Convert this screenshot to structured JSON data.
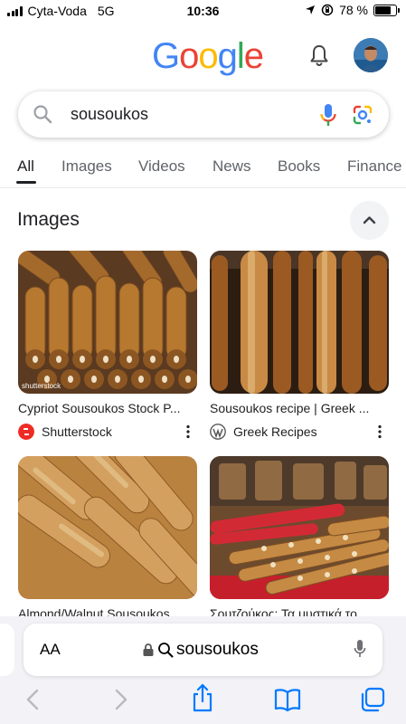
{
  "status_bar": {
    "carrier": "Cyta-Voda",
    "network": "5G",
    "time": "10:36",
    "battery": "78 %",
    "battery_level": 0.78
  },
  "header": {
    "logo_text": [
      "G",
      "o",
      "o",
      "g",
      "l",
      "e"
    ],
    "logo_colors": [
      "#4285F4",
      "#EA4335",
      "#FBBC05",
      "#4285F4",
      "#34A853",
      "#EA4335"
    ],
    "bell_icon": "bell-icon",
    "avatar_icon": "user-avatar"
  },
  "search": {
    "query": "sousoukos",
    "search_icon": "search-icon",
    "mic_icon": "mic-icon",
    "lens_icon": "google-lens-icon"
  },
  "tabs": [
    "All",
    "Images",
    "Videos",
    "News",
    "Books",
    "Finance"
  ],
  "images_section": {
    "title": "Images",
    "collapse_icon": "chevron-up-icon",
    "results": [
      {
        "caption": "Cypriot Sousoukos Stock P...",
        "source": "Shutterstock",
        "watermark": "shutterstock",
        "favicon_color": "#ee2b24"
      },
      {
        "caption": "Sousoukos recipe | Greek ...",
        "source": "Greek Recipes",
        "favicon_color": "#ffffff"
      },
      {
        "caption": "Almond/Walnut Sousoukos ..."
      },
      {
        "caption": "Σουτζούκος: Τα μυστικά το..."
      }
    ]
  },
  "safari": {
    "aa_label": "AA",
    "url_text": "sousoukos",
    "lock_icon": "lock-icon",
    "icons": [
      "back-arrow-icon",
      "forward-arrow-icon",
      "share-icon",
      "bookmarks-icon",
      "tabs-icon"
    ],
    "accent": "#007aff"
  }
}
